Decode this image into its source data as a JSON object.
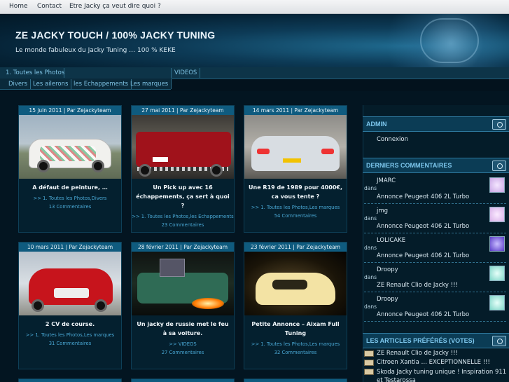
{
  "topnav": {
    "home": "Home",
    "contact": "Contact",
    "about": "Etre Jacky ça veut dire quoi ?"
  },
  "header": {
    "title": "ZE JACKY TOUCH / 100% JACKY TUNING",
    "tagline": "Le monde fabuleux du Jacky Tuning … 100 % KEKE"
  },
  "nav": {
    "row1": [
      "1. Toutes les Photos",
      "VIDEOS"
    ],
    "row2": [
      "Divers",
      "Les ailerons",
      "les Echappements",
      "Les marques"
    ]
  },
  "posts": [
    {
      "meta": "15 juin 2011 | Par Zejackyteam",
      "title": "A défaut de peinture, …",
      "cats": ">> 1. Toutes les Photos,Divers",
      "comments": "13 Commentaires",
      "thumb": "white-car-graffiti"
    },
    {
      "meta": "27 mai 2011 | Par Zejackyteam",
      "title": "Un Pick up avec 16 échappements, ça sert à quoi ?",
      "cats": ">> 1. Toutes les Photos,les Echappements",
      "comments": "23 Commentaires",
      "thumb": "red-pickup"
    },
    {
      "meta": "14 mars 2011 | Par Zejackyteam",
      "title": "Une R19 de 1989 pour 4000€, ca vous tente ?",
      "cats": ">> 1. Toutes les Photos,Les marques",
      "comments": "54 Commentaires",
      "thumb": "grey-r19"
    },
    {
      "meta": "10 mars 2011 | Par Zejackyteam",
      "title": "2 CV de course.",
      "cats": ">> 1. Toutes les Photos,Les marques",
      "comments": "31 Commentaires",
      "thumb": "red-2cv"
    },
    {
      "meta": "28 février 2011 | Par Zejackyteam",
      "title": "Un jacky de russie met le feu à sa voiture.",
      "cats": ">> VIDEOS",
      "comments": "27 Commentaires",
      "thumb": "green-car-night"
    },
    {
      "meta": "23 février 2011 | Par Zejackyteam",
      "title": "Petite Annonce – Aixam Full Tuning",
      "cats": ">> 1. Toutes les Photos,Les marques",
      "comments": "32 Commentaires",
      "thumb": "yellow-car-dark"
    }
  ],
  "sidebar": {
    "admin": {
      "heading": "ADMIN",
      "link": "Connexion"
    },
    "comments": {
      "heading": "DERNIERS COMMENTAIRES",
      "dans": "dans",
      "items": [
        {
          "author": "JMARC",
          "post": "Annonce Peugeot 406 2L Turbo",
          "avatar": "#c9a7e6"
        },
        {
          "author": "jmg",
          "post": "Annonce Peugeot 406 2L Turbo",
          "avatar": "#d7b0e8"
        },
        {
          "author": "LOLICAKE",
          "post": "Annonce Peugeot 406 2L Turbo",
          "avatar": "#5a3cc8"
        },
        {
          "author": "Droopy",
          "post": "ZE Renault Clio de Jacky !!!",
          "avatar": "#7fd6c9"
        },
        {
          "author": "Droopy",
          "post": "Annonce Peugeot 406 2L Turbo",
          "avatar": "#7fd6c9"
        }
      ]
    },
    "favorites": {
      "heading": "LES ARTICLES PRÉFÉRÉS (VOTES)",
      "items": [
        "ZE Renault Clio de Jacky !!!",
        "Citroen Xantia … EXCEPTIONNELLE !!!",
        "Skoda Jacky tuning unique ! Inspiration 911 et Testarossa"
      ]
    }
  },
  "colors": {
    "accent": "#0f5b7f",
    "link": "#4aa9d6",
    "background": "#03121d"
  }
}
